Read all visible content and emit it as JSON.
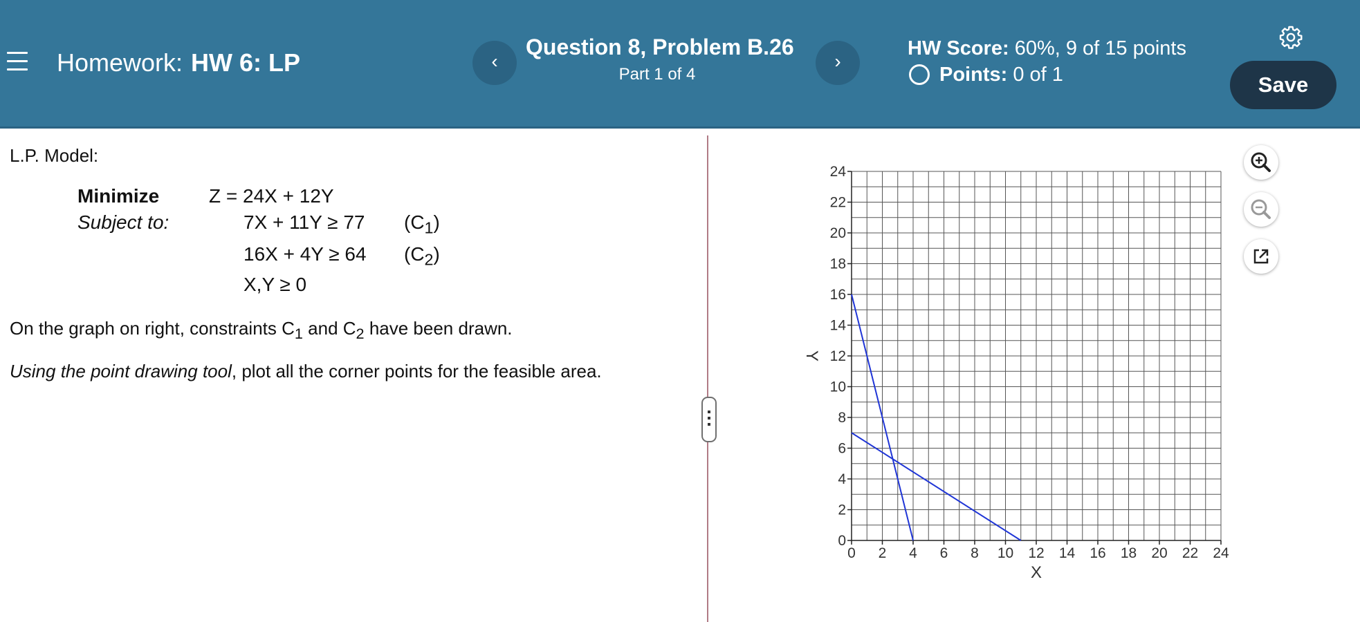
{
  "header": {
    "homework_prefix": "Homework:",
    "homework_name": "HW 6: LP",
    "prev_label": "‹",
    "next_label": "›",
    "question_title": "Question 8, Problem B.26",
    "part": "Part 1 of 4",
    "hw_score_label": "HW Score:",
    "hw_score_value": "60%, 9 of 15 points",
    "points_label": "Points:",
    "points_value": "0 of 1",
    "save_label": "Save",
    "colors": {
      "bar": "#347699",
      "save": "#1e3548"
    }
  },
  "problem": {
    "model_label": "L.P. Model:",
    "minimize_label": "Minimize",
    "objective": "Z = 24X + 12Y",
    "subject_to_label": "Subject to:",
    "constraint1": "7X + 11Y ≥ 77",
    "constraint1_tag_pre": "(C",
    "constraint1_tag_sub": "1",
    "constraint1_tag_post": ")",
    "constraint2": "16X + 4Y ≥ 64",
    "constraint2_tag_pre": "(C",
    "constraint2_tag_sub": "2",
    "constraint2_tag_post": ")",
    "nonnegativity": "X,Y ≥ 0",
    "para1_a": "On the graph on right, constraints C",
    "para1_sub1": "1",
    "para1_b": " and C",
    "para1_sub2": "2",
    "para1_c": " have been drawn.",
    "para2_italic": "Using the point drawing tool",
    "para2_rest": ", plot all the corner points for the feasible area."
  },
  "tools": [
    "zoom-in-icon",
    "zoom-out-icon",
    "popout-icon"
  ],
  "chart_data": {
    "type": "line",
    "xlabel": "X",
    "ylabel": "Y",
    "xlim": [
      0,
      24
    ],
    "ylim": [
      0,
      24
    ],
    "x_ticks": [
      0,
      2,
      4,
      6,
      8,
      10,
      12,
      14,
      16,
      18,
      20,
      22,
      24
    ],
    "y_ticks": [
      0,
      2,
      4,
      6,
      8,
      10,
      12,
      14,
      16,
      18,
      20,
      22,
      24
    ],
    "grid": true,
    "line_color": "#1f35d6",
    "series": [
      {
        "points": [
          [
            0,
            7
          ],
          [
            11,
            0
          ]
        ]
      },
      {
        "points": [
          [
            0,
            16
          ],
          [
            4,
            0
          ]
        ]
      }
    ]
  }
}
